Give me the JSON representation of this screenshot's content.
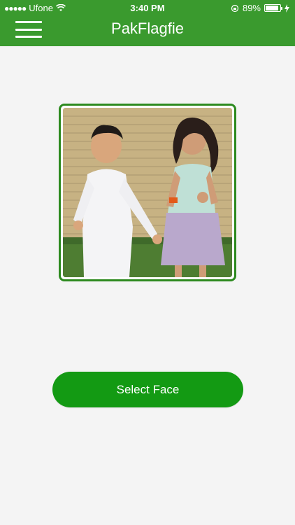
{
  "status_bar": {
    "carrier": "Ufone",
    "time": "3:40 PM",
    "battery": "89%",
    "battery_level": 0.89
  },
  "header": {
    "title": "PakFlagfie",
    "menu_icon": "hamburger-menu-icon"
  },
  "photo": {
    "description_icon": "photo-image"
  },
  "select_face_button": {
    "label": "Select Face"
  },
  "colors": {
    "header_bg": "#3a9a2e",
    "button_bg": "#139a13",
    "frame_border": "#2d8a1f",
    "page_bg": "#f4f4f4"
  }
}
